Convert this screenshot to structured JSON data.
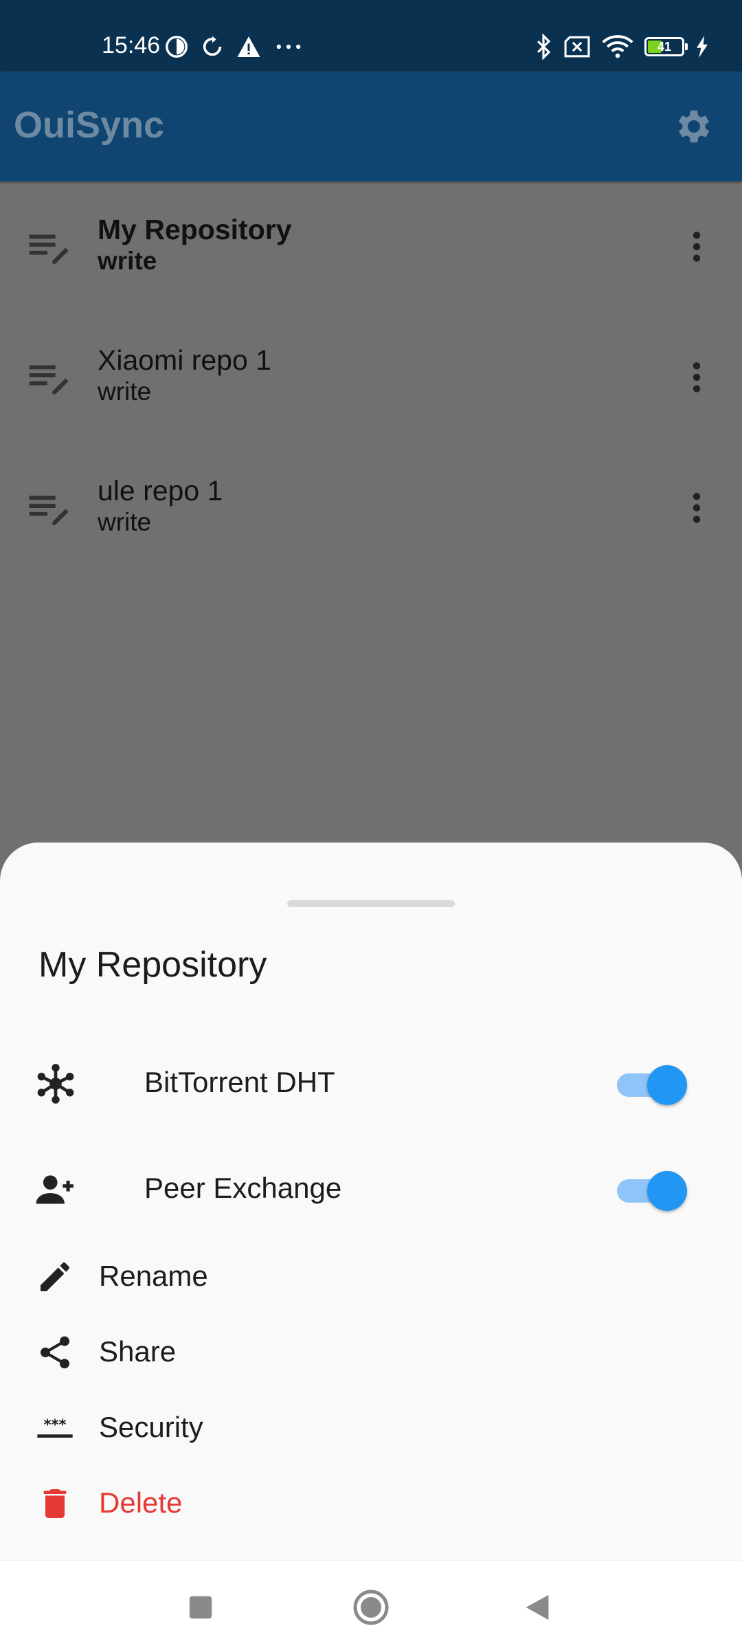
{
  "status_bar": {
    "time": "15:46",
    "left_icons": [
      "data-saver-icon",
      "sync-icon",
      "warning-icon",
      "more-notifications-icon"
    ],
    "right_icons": [
      "bluetooth-icon",
      "no-sim-icon",
      "wifi-icon",
      "battery-icon",
      "charging-icon"
    ],
    "battery_level": "41",
    "background": "#0b3150"
  },
  "app_bar": {
    "title": "OuiSync",
    "settings_icon": "gear-icon",
    "background": "#0f4570"
  },
  "repositories": [
    {
      "name": "My Repository",
      "access": "write",
      "icon": "edit-note-icon",
      "selected": true
    },
    {
      "name": "Xiaomi repo 1",
      "access": "write",
      "icon": "edit-note-icon",
      "selected": false
    },
    {
      "name": "ule repo 1",
      "access": "write",
      "icon": "edit-note-icon",
      "selected": false
    }
  ],
  "sheet": {
    "title": "My Repository",
    "toggles": [
      {
        "label": "BitTorrent DHT",
        "icon": "dht-network-icon",
        "on": true
      },
      {
        "label": "Peer Exchange",
        "icon": "add-person-icon",
        "on": true
      }
    ],
    "actions": [
      {
        "label": "Rename",
        "icon": "pencil-icon"
      },
      {
        "label": "Share",
        "icon": "share-icon"
      },
      {
        "label": "Security",
        "icon": "password-icon"
      },
      {
        "label": "Delete",
        "icon": "trash-icon",
        "danger": true
      }
    ],
    "accent": "#2196f3",
    "danger_color": "#e53935"
  },
  "nav_bar": {
    "buttons": [
      "recents-square-icon",
      "home-circle-icon",
      "back-triangle-icon"
    ]
  }
}
